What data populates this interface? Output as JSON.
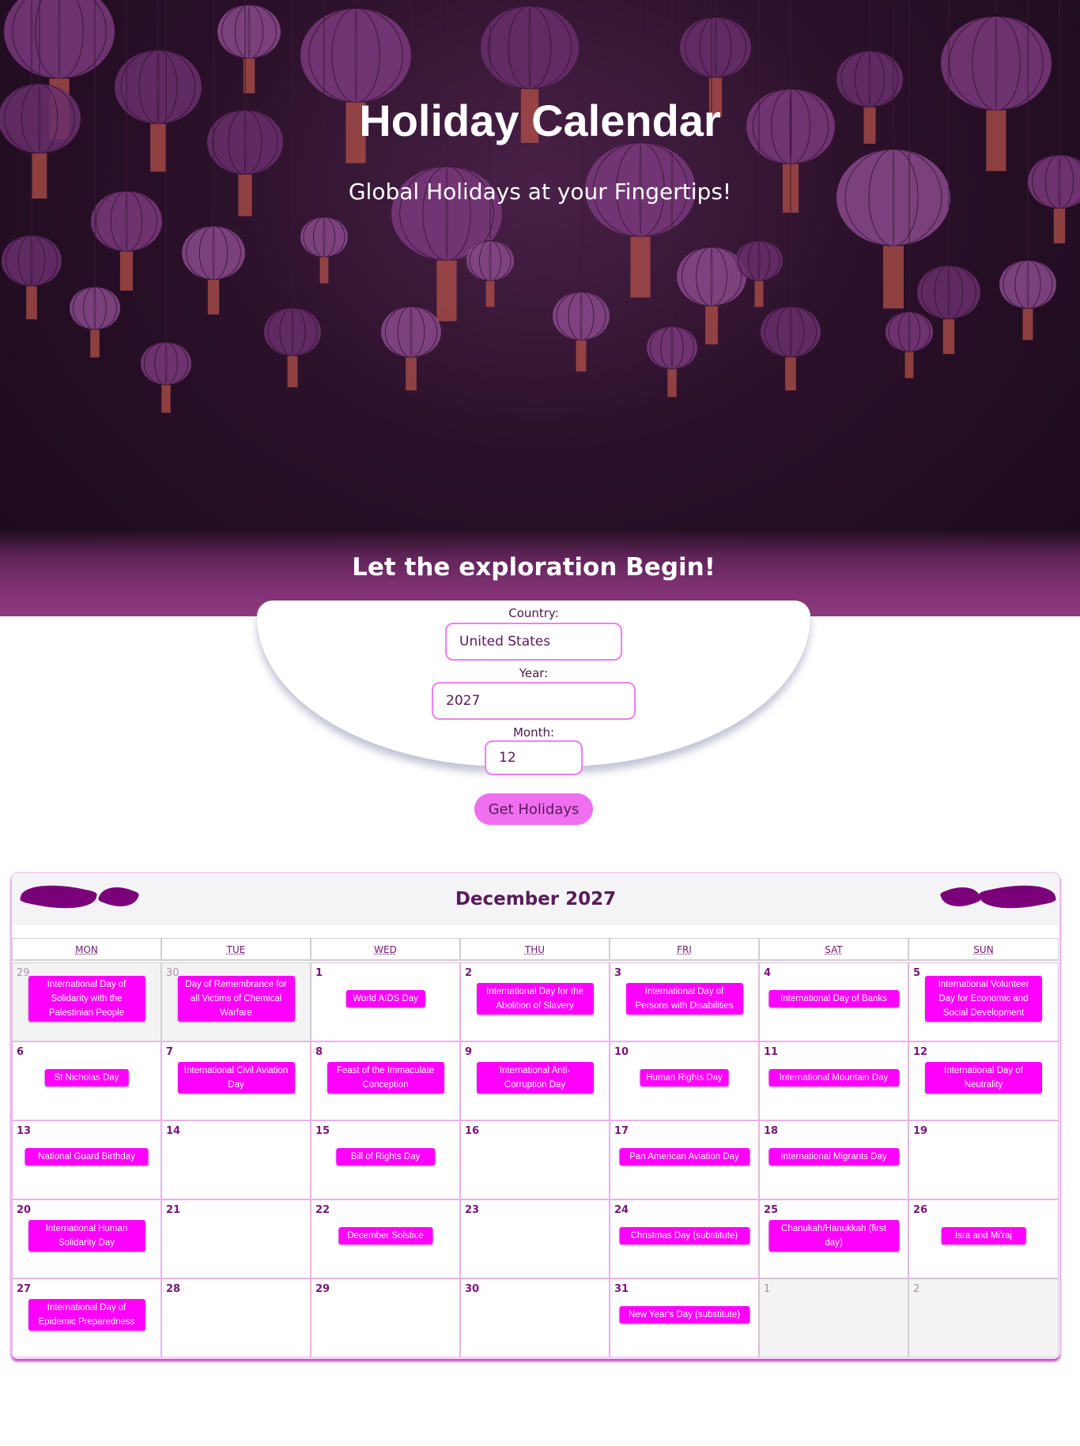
{
  "hero": {
    "title": "Holiday Calendar",
    "subtitle": "Global Holidays at your Fingertips!",
    "tagline": "Let the exploration Begin!"
  },
  "form": {
    "country_label": "Country:",
    "country_value": "United States",
    "year_label": "Year:",
    "year_value": "2027",
    "month_label": "Month:",
    "month_value": "12",
    "submit_label": "Get Holidays"
  },
  "calendar": {
    "title": "December 2027",
    "weekdays": [
      "MON",
      "TUE",
      "WED",
      "THU",
      "FRI",
      "SAT",
      "SUN"
    ],
    "weeks": [
      [
        {
          "day": "29",
          "other": true,
          "event": "International Day of Solidarity with the Palestinian People"
        },
        {
          "day": "30",
          "other": true,
          "event": "Day of Remembrance for all Victims of Chemical Warfare"
        },
        {
          "day": "1",
          "other": false,
          "event": "World AIDS Day"
        },
        {
          "day": "2",
          "other": false,
          "event": "International Day for the Abolition of Slavery"
        },
        {
          "day": "3",
          "other": false,
          "event": "International Day of Persons with Disabilities"
        },
        {
          "day": "4",
          "other": false,
          "event": "International Day of Banks"
        },
        {
          "day": "5",
          "other": false,
          "event": "International Volunteer Day for Economic and Social Development"
        }
      ],
      [
        {
          "day": "6",
          "other": false,
          "event": "St Nicholas Day"
        },
        {
          "day": "7",
          "other": false,
          "event": "International Civil Aviation Day"
        },
        {
          "day": "8",
          "other": false,
          "event": "Feast of the Immaculate Conception"
        },
        {
          "day": "9",
          "other": false,
          "event": "International Anti-Corruption Day"
        },
        {
          "day": "10",
          "other": false,
          "event": "Human Rights Day"
        },
        {
          "day": "11",
          "other": false,
          "event": "International Mountain Day"
        },
        {
          "day": "12",
          "other": false,
          "event": "International Day of Neutrality"
        }
      ],
      [
        {
          "day": "13",
          "other": false,
          "event": "National Guard Birthday"
        },
        {
          "day": "14",
          "other": false,
          "event": ""
        },
        {
          "day": "15",
          "other": false,
          "event": "Bill of Rights Day"
        },
        {
          "day": "16",
          "other": false,
          "event": ""
        },
        {
          "day": "17",
          "other": false,
          "event": "Pan American Aviation Day"
        },
        {
          "day": "18",
          "other": false,
          "event": "International Migrants Day"
        },
        {
          "day": "19",
          "other": false,
          "event": ""
        }
      ],
      [
        {
          "day": "20",
          "other": false,
          "event": "International Human Solidarity Day"
        },
        {
          "day": "21",
          "other": false,
          "event": ""
        },
        {
          "day": "22",
          "other": false,
          "event": "December Solstice"
        },
        {
          "day": "23",
          "other": false,
          "event": ""
        },
        {
          "day": "24",
          "other": false,
          "event": "Christmas Day (substitute)"
        },
        {
          "day": "25",
          "other": false,
          "event": "Chanukah/Hanukkah (first day)"
        },
        {
          "day": "26",
          "other": false,
          "event": "Isra and Mi'raj"
        }
      ],
      [
        {
          "day": "27",
          "other": false,
          "event": "International Day of Epidemic Preparedness"
        },
        {
          "day": "28",
          "other": false,
          "event": ""
        },
        {
          "day": "29",
          "other": false,
          "event": ""
        },
        {
          "day": "30",
          "other": false,
          "event": ""
        },
        {
          "day": "31",
          "other": false,
          "event": "New Year's Day (substitute)"
        },
        {
          "day": "1",
          "other": true,
          "event": ""
        },
        {
          "day": "2",
          "other": true,
          "event": ""
        }
      ]
    ]
  },
  "colors": {
    "accent": "#ff00ff",
    "button": "#ef6fef",
    "text_dark": "#5a1a5a",
    "hero_bg": "#2a1029"
  }
}
